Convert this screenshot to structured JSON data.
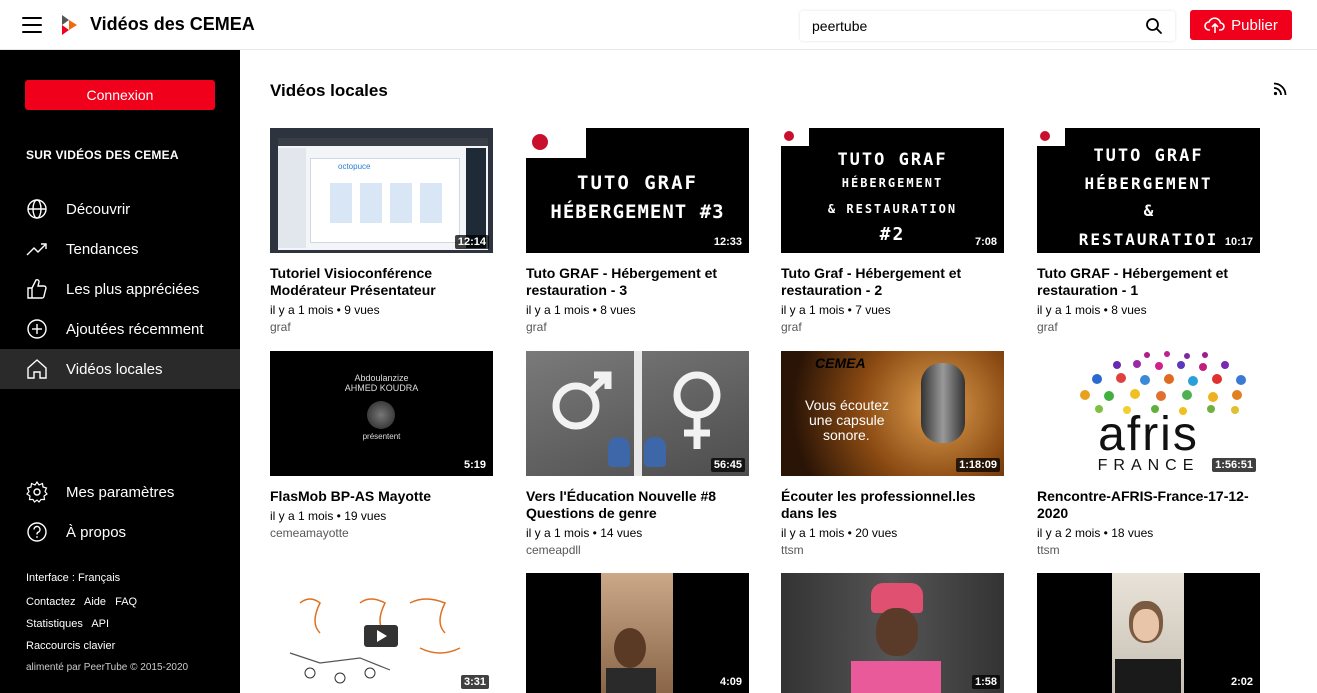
{
  "header": {
    "brand": "Vidéos des CEMEA",
    "search_value": "peertube",
    "upload_label": "Publier",
    "accent": "#f1001c"
  },
  "sidebar": {
    "login_label": "Connexion",
    "section_title": "SUR VIDÉOS DES CEMEA",
    "items": [
      {
        "label": "Découvrir",
        "icon": "globe-icon"
      },
      {
        "label": "Tendances",
        "icon": "trending-icon"
      },
      {
        "label": "Les plus appréciées",
        "icon": "thumbs-up-icon"
      },
      {
        "label": "Ajoutées récemment",
        "icon": "plus-circle-icon"
      },
      {
        "label": "Vidéos locales",
        "icon": "home-icon",
        "active": true
      }
    ],
    "bottom_items": [
      {
        "label": "Mes paramètres",
        "icon": "cog-icon"
      },
      {
        "label": "À propos",
        "icon": "help-icon"
      }
    ],
    "footer": {
      "interface": "Interface : Français",
      "contact": "Contactez",
      "help": "Aide",
      "faq": "FAQ",
      "stats": "Statistiques",
      "api": "API",
      "shortcuts": "Raccourcis clavier",
      "powered_by": "alimenté par PeerTube",
      "copyright": "© 2015-2020"
    }
  },
  "main": {
    "title": "Vidéos locales",
    "videos": [
      {
        "title": "Tutoriel Visioconférence Modérateur Présentateur",
        "meta": "il y a 1 mois • 9 vues",
        "channel": "graf",
        "duration": "12:14"
      },
      {
        "title": "Tuto GRAF - Hébergement et restauration - 3",
        "meta": "il y a 1 mois • 8 vues",
        "channel": "graf",
        "duration": "12:33"
      },
      {
        "title": "Tuto Graf - Hébergement et restauration - 2",
        "meta": "il y a 1 mois • 7 vues",
        "channel": "graf",
        "duration": "7:08"
      },
      {
        "title": "Tuto GRAF - Hébergement et restauration - 1",
        "meta": "il y a 1 mois • 8 vues",
        "channel": "graf",
        "duration": "10:17"
      },
      {
        "title": "FlasMob BP-AS Mayotte",
        "meta": "il y a 1 mois • 19 vues",
        "channel": "cemeamayotte",
        "duration": "5:19"
      },
      {
        "title": "Vers l'Éducation Nouvelle #8 Questions de genre",
        "meta": "il y a 1 mois • 14 vues",
        "channel": "cemeapdll",
        "duration": "56:45"
      },
      {
        "title": "Écouter les professionnel.les dans les",
        "meta": "il y a 1 mois • 20 vues",
        "channel": "ttsm",
        "duration": "1:18:09"
      },
      {
        "title": "Rencontre-AFRIS-France-17-12-2020",
        "meta": "il y a 2 mois • 18 vues",
        "channel": "ttsm",
        "duration": "1:56:51"
      },
      {
        "duration": "3:31"
      },
      {
        "duration": "4:09"
      },
      {
        "duration": "1:58"
      },
      {
        "duration": "2:02"
      }
    ],
    "thumb_text": {
      "graf3": [
        "TUTO GRAF",
        "HÉBERGEMENT #3"
      ],
      "graf2": [
        "TUTO GRAF",
        "HÉBERGEMENT",
        "& RESTAURATION",
        "#2"
      ],
      "graf1": [
        "TUTO GRAF",
        "HÉBERGEMENT",
        "&",
        "RESTAURATIOI"
      ],
      "flashmob": [
        "Abdoulanzize",
        "AHMED KOUDRA",
        "présentent"
      ],
      "afris": [
        "afris",
        "FRANCE"
      ],
      "capsule": [
        "CEMEA",
        "Vous écoutez",
        "une capsule",
        "sonore."
      ]
    }
  }
}
